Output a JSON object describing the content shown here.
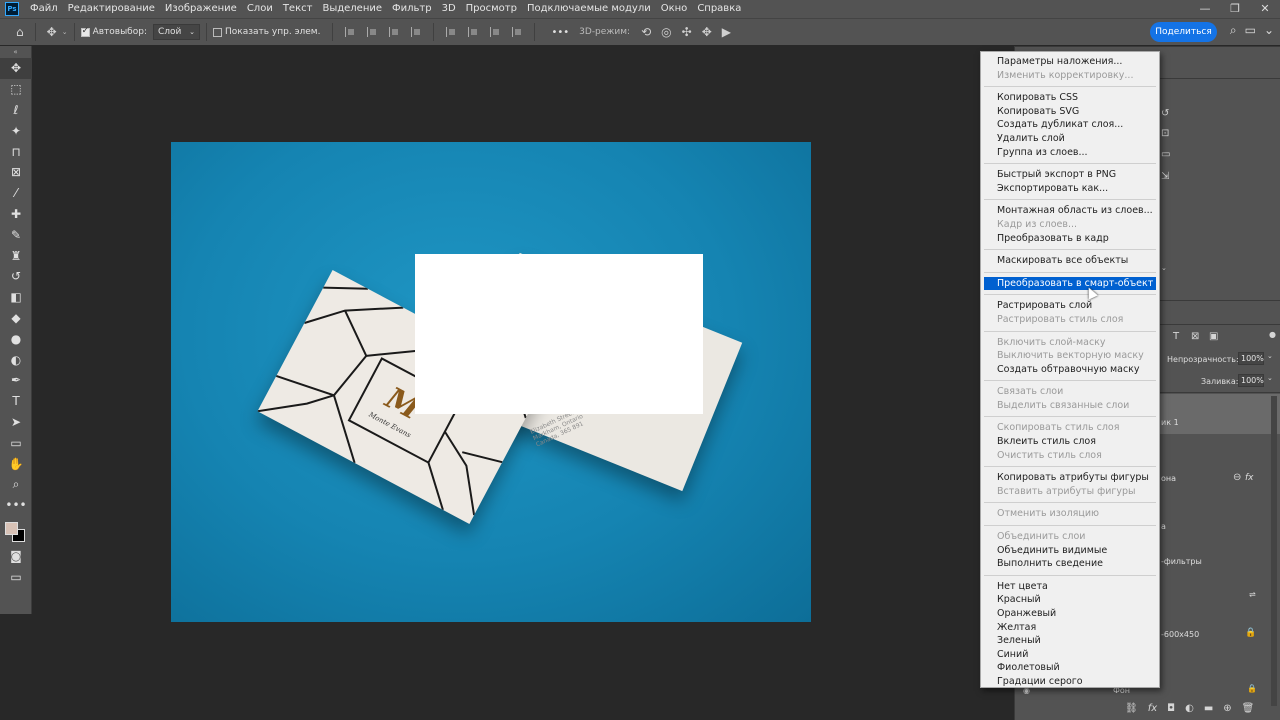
{
  "menubar": {
    "logo": "Ps",
    "items": [
      "Файл",
      "Редактирование",
      "Изображение",
      "Слои",
      "Текст",
      "Выделение",
      "Фильтр",
      "3D",
      "Просмотр",
      "Подключаемые модули",
      "Окно",
      "Справка"
    ],
    "window_controls": [
      "—",
      "❐",
      "✕"
    ]
  },
  "optionsbar": {
    "autoselect_label": "Автовыбор:",
    "autoselect_value": "Слой",
    "show_transform_label": "Показать упр. элем.",
    "more_icon": "•••",
    "mode3d_label": "3D-режим:",
    "share_label": "Поделиться"
  },
  "toolbar": {
    "collapse": "«",
    "tools": [
      {
        "icon": "move-icon",
        "glyph": "✥",
        "active": true
      },
      {
        "icon": "marquee-icon",
        "glyph": "⬚",
        "active": false
      },
      {
        "icon": "lasso-icon",
        "glyph": "ℓ",
        "active": false
      },
      {
        "icon": "magic-wand-icon",
        "glyph": "✦",
        "active": false
      },
      {
        "icon": "crop-icon",
        "glyph": "⊓",
        "active": false
      },
      {
        "icon": "frame-icon",
        "glyph": "⊠",
        "active": false
      },
      {
        "icon": "eyedropper-icon",
        "glyph": "⁄",
        "active": false
      },
      {
        "icon": "healing-brush-icon",
        "glyph": "✚",
        "active": false
      },
      {
        "icon": "brush-icon",
        "glyph": "✎",
        "active": false
      },
      {
        "icon": "clone-stamp-icon",
        "glyph": "♜",
        "active": false
      },
      {
        "icon": "history-brush-icon",
        "glyph": "↺",
        "active": false
      },
      {
        "icon": "eraser-icon",
        "glyph": "◧",
        "active": false
      },
      {
        "icon": "paint-bucket-icon",
        "glyph": "◆",
        "active": false
      },
      {
        "icon": "blur-icon",
        "glyph": "●",
        "active": false
      },
      {
        "icon": "dodge-icon",
        "glyph": "◐",
        "active": false
      },
      {
        "icon": "pen-icon",
        "glyph": "✒",
        "active": false
      },
      {
        "icon": "type-icon",
        "glyph": "T",
        "active": false
      },
      {
        "icon": "path-selection-icon",
        "glyph": "➤",
        "active": false
      },
      {
        "icon": "rectangle-icon",
        "glyph": "▭",
        "active": false
      },
      {
        "icon": "hand-icon",
        "glyph": "✋",
        "active": false
      },
      {
        "icon": "zoom-icon",
        "glyph": "⌕",
        "active": false
      },
      {
        "icon": "more-tools-icon",
        "glyph": "•••",
        "active": false
      }
    ]
  },
  "rightpanel": {
    "opacity_label": "Непрозрачность:",
    "opacity_value": "100%",
    "fill_label": "Заливка:",
    "fill_value": "100%",
    "layer_fragments": [
      "ик 1",
      "она",
      "а",
      "-фильтры",
      "-600x450",
      "Фон"
    ],
    "fx_label": "fx"
  },
  "context_menu": {
    "groups": [
      [
        {
          "label": "Параметры наложения...",
          "enabled": true
        },
        {
          "label": "Изменить корректировку...",
          "enabled": false
        }
      ],
      [
        {
          "label": "Копировать CSS",
          "enabled": true
        },
        {
          "label": "Копировать SVG",
          "enabled": true
        },
        {
          "label": "Создать дубликат слоя...",
          "enabled": true
        },
        {
          "label": "Удалить слой",
          "enabled": true
        },
        {
          "label": "Группа из слоев...",
          "enabled": true
        }
      ],
      [
        {
          "label": "Быстрый экспорт в PNG",
          "enabled": true
        },
        {
          "label": "Экспортировать как...",
          "enabled": true
        }
      ],
      [
        {
          "label": "Монтажная область из слоев...",
          "enabled": true
        },
        {
          "label": "Кадр из слоев...",
          "enabled": false
        },
        {
          "label": "Преобразовать в кадр",
          "enabled": true
        }
      ],
      [
        {
          "label": "Маскировать все объекты",
          "enabled": true
        }
      ],
      [
        {
          "label": "Преобразовать в смарт-объект",
          "enabled": true,
          "highlighted": true
        }
      ],
      [
        {
          "label": "Растрировать слой",
          "enabled": true
        },
        {
          "label": "Растрировать стиль слоя",
          "enabled": false
        }
      ],
      [
        {
          "label": "Включить слой-маску",
          "enabled": false
        },
        {
          "label": "Выключить векторную маску",
          "enabled": false
        },
        {
          "label": "Создать обтравочную маску",
          "enabled": true
        }
      ],
      [
        {
          "label": "Связать слои",
          "enabled": false
        },
        {
          "label": "Выделить связанные слои",
          "enabled": false
        }
      ],
      [
        {
          "label": "Скопировать стиль слоя",
          "enabled": false
        },
        {
          "label": "Вклеить стиль слоя",
          "enabled": true
        },
        {
          "label": "Очистить стиль слоя",
          "enabled": false
        }
      ],
      [
        {
          "label": "Копировать атрибуты фигуры",
          "enabled": true
        },
        {
          "label": "Вставить атрибуты фигуры",
          "enabled": false
        }
      ],
      [
        {
          "label": "Отменить изоляцию",
          "enabled": false
        }
      ],
      [
        {
          "label": "Объединить слои",
          "enabled": false
        },
        {
          "label": "Объединить видимые",
          "enabled": true
        },
        {
          "label": "Выполнить сведение",
          "enabled": true
        }
      ],
      [
        {
          "label": "Нет цвета",
          "enabled": true
        },
        {
          "label": "Красный",
          "enabled": true
        },
        {
          "label": "Оранжевый",
          "enabled": true
        },
        {
          "label": "Желтая",
          "enabled": true
        },
        {
          "label": "Зеленый",
          "enabled": true
        },
        {
          "label": "Синий",
          "enabled": true
        },
        {
          "label": "Фиолетовый",
          "enabled": true
        },
        {
          "label": "Градации серого",
          "enabled": true
        }
      ]
    ]
  },
  "canvas": {
    "card_logo_text": "M",
    "card_name_text": "Monte Evans",
    "card_address_text": "Elizabeth Street\nMarkham, Ontario\nCanada, 365 891",
    "colors": {
      "background": "#1584b2",
      "card": "#eeeae4",
      "accent": "#8a5a1c"
    }
  }
}
